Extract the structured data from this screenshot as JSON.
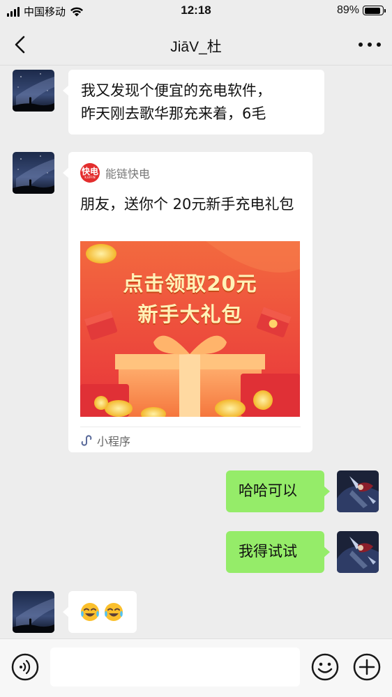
{
  "status_bar": {
    "carrier": "中国移动",
    "time": "12:18",
    "battery_percent": "89%",
    "battery_level": 0.89,
    "icons": [
      "signal-icon",
      "wifi-icon",
      "battery-icon"
    ]
  },
  "nav": {
    "title": "JiāV_杜",
    "back_icon": "chevron-left-icon",
    "more_icon": "more-dots-icon"
  },
  "messages": [
    {
      "side": "left",
      "lines": [
        "我又发现个便宜的充电软件，",
        "昨天刚去歌华那充来着，6毛"
      ]
    },
    {
      "side": "left",
      "type": "mini-program",
      "app_logo_text": "快电",
      "app_logo_subtext": "K.EFFIN",
      "app_name": "能链快电",
      "title": "朋友，送你个 20元新手充电礼包",
      "promo_line1": "点击领取20元",
      "promo_line2": "新手大礼包",
      "footer_label": "小程序",
      "footer_icon": "mini-program-icon"
    },
    {
      "side": "right",
      "text": "哈哈可以"
    },
    {
      "side": "right",
      "text": "我得试试"
    },
    {
      "side": "left",
      "text": "😭😭",
      "emoji_icons": [
        "tears-of-joy-emoji",
        "tears-of-joy-emoji"
      ]
    }
  ],
  "input_bar": {
    "voice_icon": "voice-icon",
    "input_value": "",
    "input_placeholder": "",
    "emoji_icon": "emoji-smile-icon",
    "plus_icon": "plus-circle-icon"
  },
  "colors": {
    "background": "#ededed",
    "bubble_self": "#95ec69",
    "bubble_other": "#ffffff",
    "promo_red": "#ef4a37",
    "promo_text": "#fff2b8"
  }
}
